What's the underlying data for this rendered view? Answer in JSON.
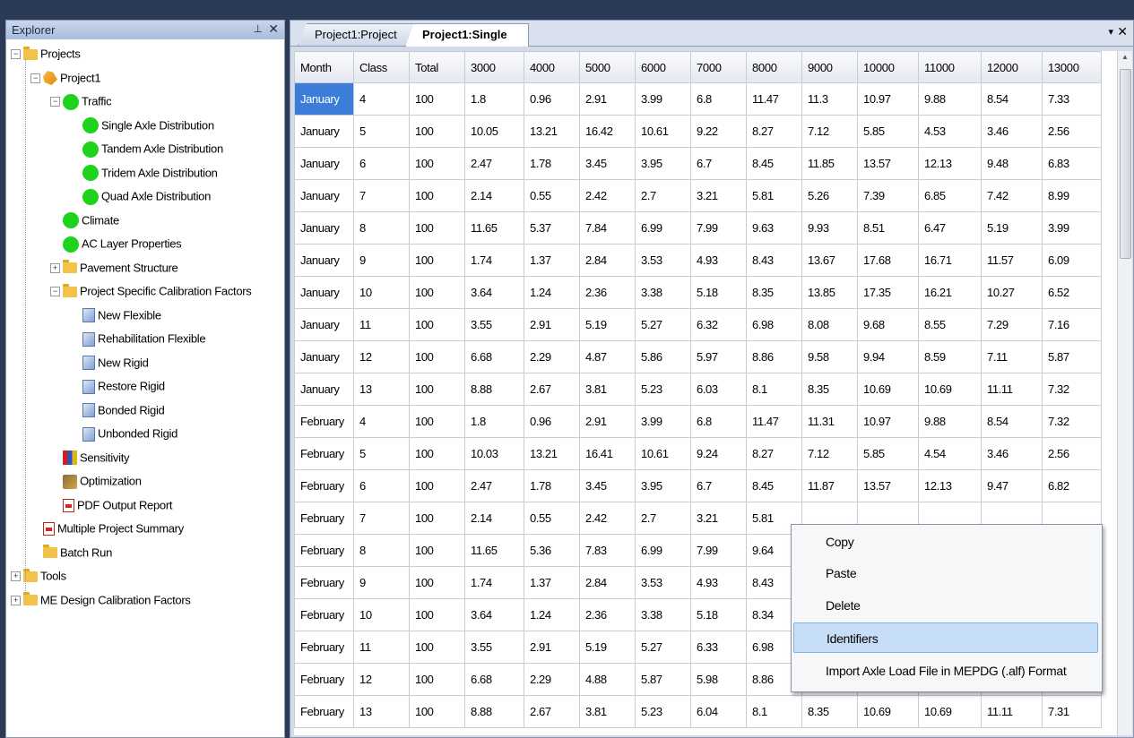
{
  "explorer": {
    "title": "Explorer",
    "pin_glyph": "⊥",
    "close_glyph": "✕",
    "tree": [
      {
        "label": "Projects",
        "icon": "folder-icon",
        "expander": "−"
      },
      {
        "label": "Project1",
        "icon": "project-icon",
        "expander": "−"
      },
      {
        "label": "Traffic",
        "icon": "green-status-icon",
        "expander": "−"
      },
      {
        "label": "Single Axle Distribution",
        "icon": "green-status-icon"
      },
      {
        "label": "Tandem Axle Distribution",
        "icon": "green-status-icon"
      },
      {
        "label": "Tridem Axle Distribution",
        "icon": "green-status-icon"
      },
      {
        "label": "Quad Axle Distribution",
        "icon": "green-status-icon"
      },
      {
        "label": "Climate",
        "icon": "green-status-icon"
      },
      {
        "label": "AC Layer Properties",
        "icon": "green-status-icon"
      },
      {
        "label": "Pavement Structure",
        "icon": "folder-icon",
        "expander": "+"
      },
      {
        "label": "Project Specific Calibration Factors",
        "icon": "folder-icon",
        "expander": "−"
      },
      {
        "label": "New Flexible",
        "icon": "page-icon"
      },
      {
        "label": "Rehabilitation Flexible",
        "icon": "page-icon"
      },
      {
        "label": "New Rigid",
        "icon": "page-icon"
      },
      {
        "label": "Restore Rigid",
        "icon": "page-icon"
      },
      {
        "label": "Bonded Rigid",
        "icon": "page-icon"
      },
      {
        "label": "Unbonded Rigid",
        "icon": "page-icon"
      },
      {
        "label": "Sensitivity",
        "icon": "sensitivity-icon"
      },
      {
        "label": "Optimization",
        "icon": "optimization-icon"
      },
      {
        "label": "PDF Output Report",
        "icon": "pdf-icon"
      },
      {
        "label": "Multiple Project Summary",
        "icon": "pdf-icon"
      },
      {
        "label": "Batch Run",
        "icon": "folder-icon"
      },
      {
        "label": "Tools",
        "icon": "folder-icon",
        "expander": "+"
      },
      {
        "label": "ME Design Calibration Factors",
        "icon": "folder-icon",
        "expander": "+"
      }
    ]
  },
  "tabs": [
    {
      "label": "Project1:Project",
      "active": false
    },
    {
      "label": "Project1:Single",
      "active": true
    }
  ],
  "tab_menu_glyph": "▾",
  "tab_close_glyph": "✕",
  "grid": {
    "columns": [
      "Month",
      "Class",
      "Total",
      "3000",
      "4000",
      "5000",
      "6000",
      "7000",
      "8000",
      "9000",
      "10000",
      "11000",
      "12000",
      "13000"
    ],
    "rows": [
      [
        "January",
        "4",
        "100",
        "1.8",
        "0.96",
        "2.91",
        "3.99",
        "6.8",
        "11.47",
        "11.3",
        "10.97",
        "9.88",
        "8.54",
        "7.33"
      ],
      [
        "January",
        "5",
        "100",
        "10.05",
        "13.21",
        "16.42",
        "10.61",
        "9.22",
        "8.27",
        "7.12",
        "5.85",
        "4.53",
        "3.46",
        "2.56"
      ],
      [
        "January",
        "6",
        "100",
        "2.47",
        "1.78",
        "3.45",
        "3.95",
        "6.7",
        "8.45",
        "11.85",
        "13.57",
        "12.13",
        "9.48",
        "6.83"
      ],
      [
        "January",
        "7",
        "100",
        "2.14",
        "0.55",
        "2.42",
        "2.7",
        "3.21",
        "5.81",
        "5.26",
        "7.39",
        "6.85",
        "7.42",
        "8.99"
      ],
      [
        "January",
        "8",
        "100",
        "11.65",
        "5.37",
        "7.84",
        "6.99",
        "7.99",
        "9.63",
        "9.93",
        "8.51",
        "6.47",
        "5.19",
        "3.99"
      ],
      [
        "January",
        "9",
        "100",
        "1.74",
        "1.37",
        "2.84",
        "3.53",
        "4.93",
        "8.43",
        "13.67",
        "17.68",
        "16.71",
        "11.57",
        "6.09"
      ],
      [
        "January",
        "10",
        "100",
        "3.64",
        "1.24",
        "2.36",
        "3.38",
        "5.18",
        "8.35",
        "13.85",
        "17.35",
        "16.21",
        "10.27",
        "6.52"
      ],
      [
        "January",
        "11",
        "100",
        "3.55",
        "2.91",
        "5.19",
        "5.27",
        "6.32",
        "6.98",
        "8.08",
        "9.68",
        "8.55",
        "7.29",
        "7.16"
      ],
      [
        "January",
        "12",
        "100",
        "6.68",
        "2.29",
        "4.87",
        "5.86",
        "5.97",
        "8.86",
        "9.58",
        "9.94",
        "8.59",
        "7.11",
        "5.87"
      ],
      [
        "January",
        "13",
        "100",
        "8.88",
        "2.67",
        "3.81",
        "5.23",
        "6.03",
        "8.1",
        "8.35",
        "10.69",
        "10.69",
        "11.11",
        "7.32"
      ],
      [
        "February",
        "4",
        "100",
        "1.8",
        "0.96",
        "2.91",
        "3.99",
        "6.8",
        "11.47",
        "11.31",
        "10.97",
        "9.88",
        "8.54",
        "7.32"
      ],
      [
        "February",
        "5",
        "100",
        "10.03",
        "13.21",
        "16.41",
        "10.61",
        "9.24",
        "8.27",
        "7.12",
        "5.85",
        "4.54",
        "3.46",
        "2.56"
      ],
      [
        "February",
        "6",
        "100",
        "2.47",
        "1.78",
        "3.45",
        "3.95",
        "6.7",
        "8.45",
        "11.87",
        "13.57",
        "12.13",
        "9.47",
        "6.82"
      ],
      [
        "February",
        "7",
        "100",
        "2.14",
        "0.55",
        "2.42",
        "2.7",
        "3.21",
        "5.81",
        "",
        "",
        "",
        "",
        ""
      ],
      [
        "February",
        "8",
        "100",
        "11.65",
        "5.36",
        "7.83",
        "6.99",
        "7.99",
        "9.64",
        "",
        "",
        "",
        "",
        ""
      ],
      [
        "February",
        "9",
        "100",
        "1.74",
        "1.37",
        "2.84",
        "3.53",
        "4.93",
        "8.43",
        "",
        "",
        "",
        "",
        ""
      ],
      [
        "February",
        "10",
        "100",
        "3.64",
        "1.24",
        "2.36",
        "3.38",
        "5.18",
        "8.34",
        "",
        "",
        "",
        "",
        ""
      ],
      [
        "February",
        "11",
        "100",
        "3.55",
        "2.91",
        "5.19",
        "5.27",
        "6.33",
        "6.98",
        "",
        "",
        "",
        "",
        ""
      ],
      [
        "February",
        "12",
        "100",
        "6.68",
        "2.29",
        "4.88",
        "5.87",
        "5.98",
        "8.86",
        "",
        "",
        "",
        "",
        ""
      ],
      [
        "February",
        "13",
        "100",
        "8.88",
        "2.67",
        "3.81",
        "5.23",
        "6.04",
        "8.1",
        "8.35",
        "10.69",
        "10.69",
        "11.11",
        "7.31"
      ]
    ],
    "selected_row": 0
  },
  "context_menu": {
    "items": [
      {
        "label": "Copy",
        "highlighted": false
      },
      {
        "label": "Paste",
        "highlighted": false
      },
      {
        "label": "Delete",
        "highlighted": false
      },
      {
        "label": "Identifiers",
        "highlighted": true
      },
      {
        "label": "Import Axle Load File in MEPDG (.alf) Format",
        "highlighted": false
      }
    ]
  },
  "colors": {
    "selection": "#3b7dd8",
    "status_green": "#1ed21e",
    "menu_highlight": "#c6def7"
  }
}
